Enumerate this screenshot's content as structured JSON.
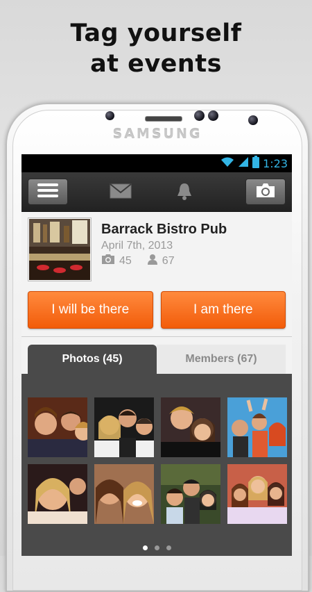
{
  "promo": {
    "headline_line1": "Tag yourself",
    "headline_line2": "at events"
  },
  "device": {
    "brand": "SAMSUNG"
  },
  "statusbar": {
    "time": "1:23",
    "accent_color": "#33b5e5"
  },
  "appbar": {
    "menu_icon": "hamburger-menu-icon",
    "messages_icon": "envelope-icon",
    "notifications_icon": "bell-icon",
    "camera_icon": "camera-icon"
  },
  "event": {
    "title": "Barrack Bistro Pub",
    "date": "April 7th, 2013",
    "photo_count": "45",
    "member_count": "67"
  },
  "actions": {
    "will_attend_label": "I will be there",
    "attending_label": "I am there",
    "button_color": "#f26b1d"
  },
  "tabs": [
    {
      "label": "Photos (45)",
      "active": true
    },
    {
      "label": "Members (67)",
      "active": false
    }
  ],
  "gallery": {
    "photos": [
      {
        "alt": "group-photo-1"
      },
      {
        "alt": "group-photo-2"
      },
      {
        "alt": "group-photo-3"
      },
      {
        "alt": "group-photo-4"
      },
      {
        "alt": "group-photo-5"
      },
      {
        "alt": "group-photo-6"
      },
      {
        "alt": "group-photo-7"
      },
      {
        "alt": "group-photo-8"
      }
    ],
    "page_indicator": {
      "pages": 3,
      "current": 1
    }
  }
}
